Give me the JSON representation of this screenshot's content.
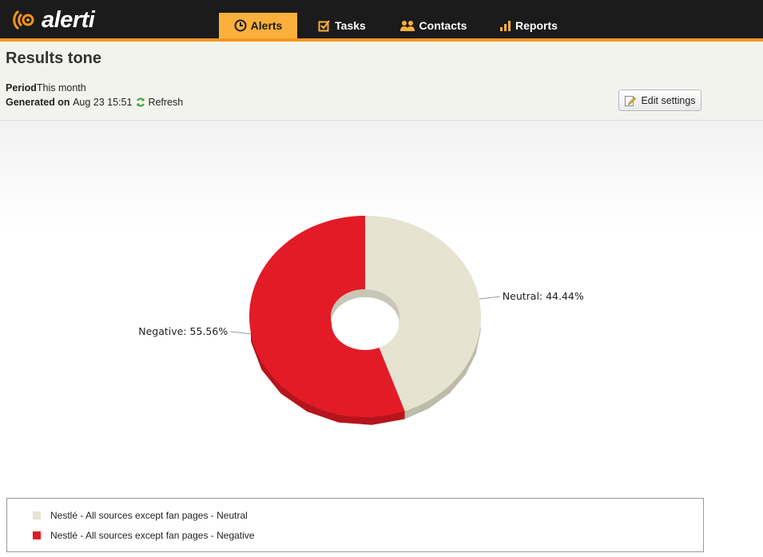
{
  "app": {
    "logo_text": "alerti"
  },
  "nav": {
    "items": [
      {
        "label": "Alerts",
        "active": true,
        "icon": "clock-icon"
      },
      {
        "label": "Tasks",
        "active": false,
        "icon": "checkbox-icon"
      },
      {
        "label": "Contacts",
        "active": false,
        "icon": "people-icon"
      },
      {
        "label": "Reports",
        "active": false,
        "icon": "bar-chart-icon"
      }
    ]
  },
  "header": {
    "title": "Results tone",
    "period_label": "Period",
    "period_value": "This month",
    "generated_label": "Generated on",
    "generated_value": "Aug 23 15:51",
    "refresh_label": "Refresh",
    "edit_settings_label": "Edit settings"
  },
  "colors": {
    "accent": "#f7941d",
    "nav_active": "#fbb03b",
    "neutral": "#e6e3d1",
    "negative": "#e21b27"
  },
  "chart_data": {
    "type": "pie",
    "donut": true,
    "slices": [
      {
        "name": "Neutral",
        "value": 44.44,
        "label": "Neutral: 44.44%",
        "color": "#e6e3d1",
        "side_color": "#bdbba9"
      },
      {
        "name": "Negative",
        "value": 55.56,
        "label": "Negative: 55.56%",
        "color": "#e21b27",
        "side_color": "#b5141d"
      }
    ],
    "legend": [
      {
        "label": "Nestlé - All sources except fan pages - Neutral",
        "color": "#e6e3d1"
      },
      {
        "label": "Nestlé - All sources except fan pages - Negative",
        "color": "#e21b27"
      }
    ],
    "legend_position": "bottom"
  }
}
